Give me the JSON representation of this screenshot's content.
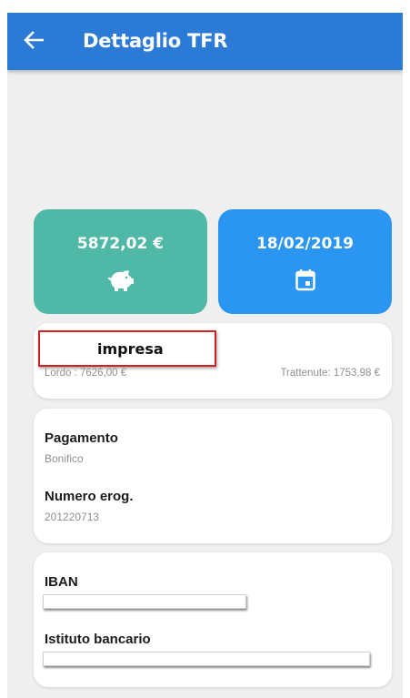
{
  "appbar": {
    "title": "Dettaglio TFR",
    "back_icon": "arrow-left-icon"
  },
  "summary": {
    "amount": "5872,02 €",
    "amount_icon": "piggy-bank-icon",
    "date": "18/02/2019",
    "date_icon": "calendar-icon"
  },
  "company": {
    "name": "impresa",
    "gross": "Lordo : 7626,00 €",
    "deductions": "Trattenute: 1753,98 €"
  },
  "payment": {
    "method_label": "Pagamento",
    "method_value": "Bonifico",
    "number_label": "Numero erog.",
    "number_value": "201220713"
  },
  "bank": {
    "iban_label": "IBAN",
    "institute_label": "Istituto bancario"
  },
  "colors": {
    "appbar": "#2b7bd6",
    "amount_tile": "#50b8a6",
    "date_tile": "#2a96f1",
    "redaction_border": "#d32222"
  }
}
